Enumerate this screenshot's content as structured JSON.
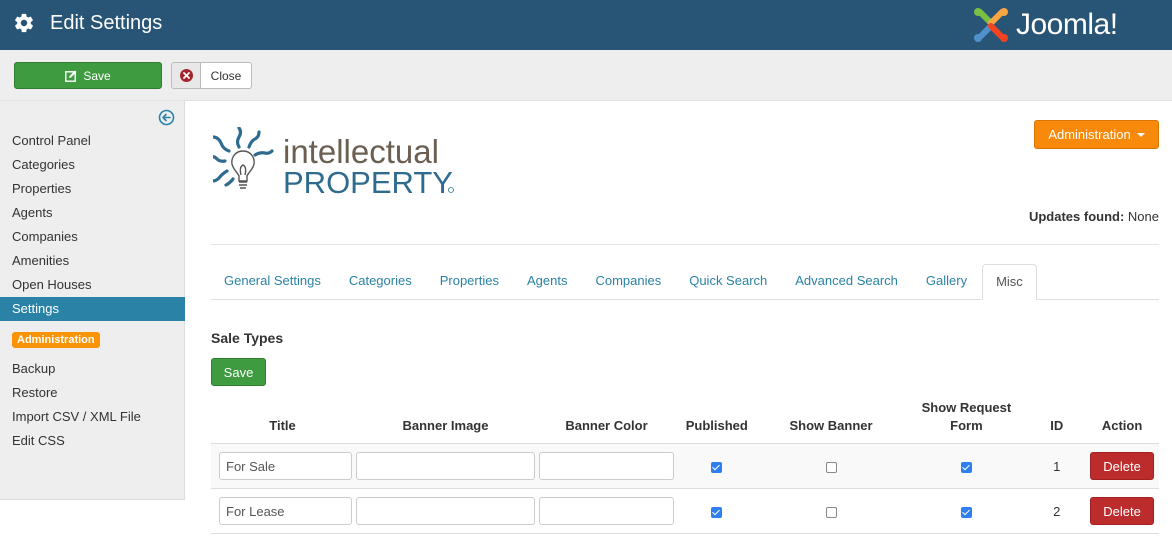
{
  "header": {
    "title": "Edit Settings",
    "brand": "Joomla!"
  },
  "toolbar": {
    "save_label": "Save",
    "close_label": "Close"
  },
  "sidebar": {
    "items": [
      {
        "label": "Control Panel",
        "active": false
      },
      {
        "label": "Categories",
        "active": false
      },
      {
        "label": "Properties",
        "active": false
      },
      {
        "label": "Agents",
        "active": false
      },
      {
        "label": "Companies",
        "active": false
      },
      {
        "label": "Amenities",
        "active": false
      },
      {
        "label": "Open Houses",
        "active": false
      },
      {
        "label": "Settings",
        "active": true
      }
    ],
    "admin_badge": "Administration",
    "admin_items": [
      {
        "label": "Backup"
      },
      {
        "label": "Restore"
      },
      {
        "label": "Import CSV / XML File"
      },
      {
        "label": "Edit CSS"
      }
    ]
  },
  "main": {
    "logo": {
      "line1": "intellectual",
      "line2": "PROPERTY"
    },
    "admin_dropdown": "Administration",
    "updates_label": "Updates found:",
    "updates_value": "None",
    "tabs": [
      {
        "label": "General Settings",
        "active": false
      },
      {
        "label": "Categories",
        "active": false
      },
      {
        "label": "Properties",
        "active": false
      },
      {
        "label": "Agents",
        "active": false
      },
      {
        "label": "Companies",
        "active": false
      },
      {
        "label": "Quick Search",
        "active": false
      },
      {
        "label": "Advanced Search",
        "active": false
      },
      {
        "label": "Gallery",
        "active": false
      },
      {
        "label": "Misc",
        "active": true
      }
    ],
    "section_title": "Sale Types",
    "save_label": "Save",
    "table": {
      "columns": [
        "Title",
        "Banner Image",
        "Banner Color",
        "Published",
        "Show Banner",
        "Show Request Form",
        "ID",
        "Action"
      ],
      "rows": [
        {
          "title": "For Sale",
          "banner_image": "",
          "banner_color": "",
          "published": true,
          "show_banner": false,
          "show_request_form": true,
          "id": "1",
          "action": "Delete"
        },
        {
          "title": "For Lease",
          "banner_image": "",
          "banner_color": "",
          "published": true,
          "show_banner": false,
          "show_request_form": true,
          "id": "2",
          "action": "Delete"
        }
      ]
    }
  },
  "colors": {
    "header_bg": "#285475",
    "accent": "#2a83a6",
    "success": "#3e9b40",
    "warning": "#f8890a",
    "danger": "#bd2c2c"
  }
}
